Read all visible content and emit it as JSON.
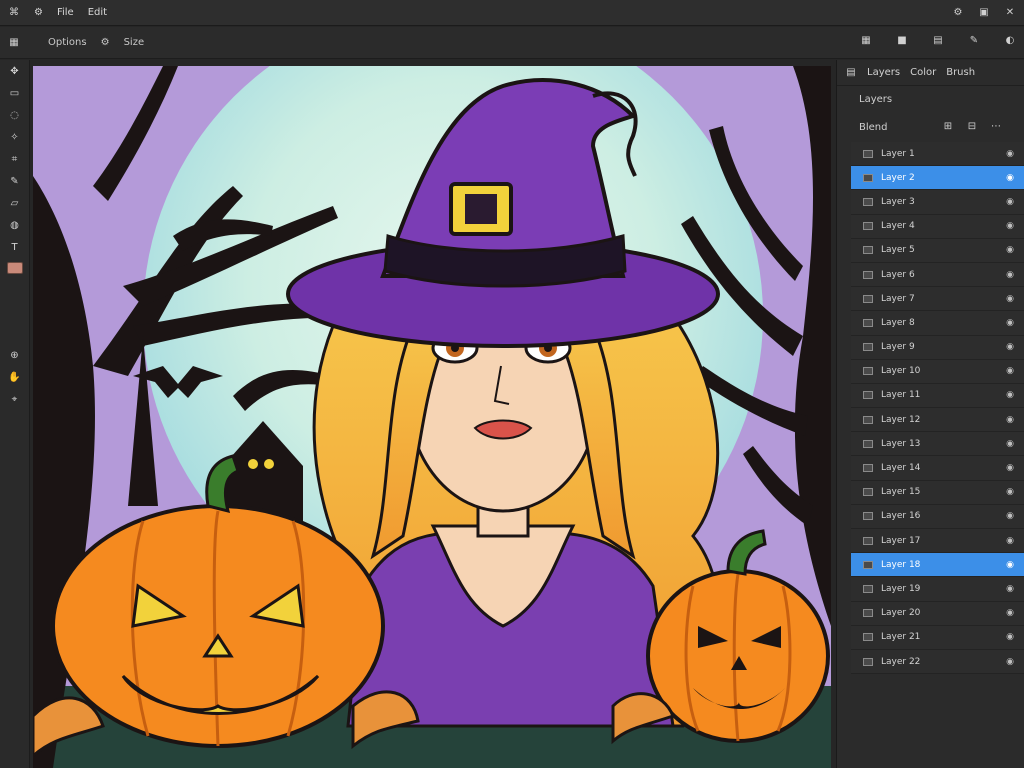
{
  "menubar": {
    "items": [
      "⌘",
      "⚙",
      "File",
      "Edit"
    ],
    "right_icons": [
      "settings-icon",
      "window-icon",
      "close-icon"
    ]
  },
  "options": {
    "items": [
      "Options",
      "⚙",
      "Size"
    ]
  },
  "panel": {
    "tabs": [
      "Layers",
      "Color",
      "Brush"
    ],
    "sub_title": "Layers",
    "layer_label": "Blend",
    "layers": [
      {
        "name": "Layer 1",
        "selected": false
      },
      {
        "name": "Layer 2",
        "selected": true
      },
      {
        "name": "Layer 3",
        "selected": false
      },
      {
        "name": "Layer 4",
        "selected": false
      },
      {
        "name": "Layer 5",
        "selected": false
      },
      {
        "name": "Layer 6",
        "selected": false
      },
      {
        "name": "Layer 7",
        "selected": false
      },
      {
        "name": "Layer 8",
        "selected": false
      },
      {
        "name": "Layer 9",
        "selected": false
      },
      {
        "name": "Layer 10",
        "selected": false
      },
      {
        "name": "Layer 11",
        "selected": false
      },
      {
        "name": "Layer 12",
        "selected": false
      },
      {
        "name": "Layer 13",
        "selected": false
      },
      {
        "name": "Layer 14",
        "selected": false
      },
      {
        "name": "Layer 15",
        "selected": false
      },
      {
        "name": "Layer 16",
        "selected": false
      },
      {
        "name": "Layer 17",
        "selected": false
      },
      {
        "name": "Layer 18",
        "selected": true
      },
      {
        "name": "Layer 19",
        "selected": false
      },
      {
        "name": "Layer 20",
        "selected": false
      },
      {
        "name": "Layer 21",
        "selected": false
      },
      {
        "name": "Layer 22",
        "selected": false
      }
    ]
  },
  "colors": {
    "accent": "#3c8fe8",
    "foreground_swatch": "#c98a7a"
  }
}
